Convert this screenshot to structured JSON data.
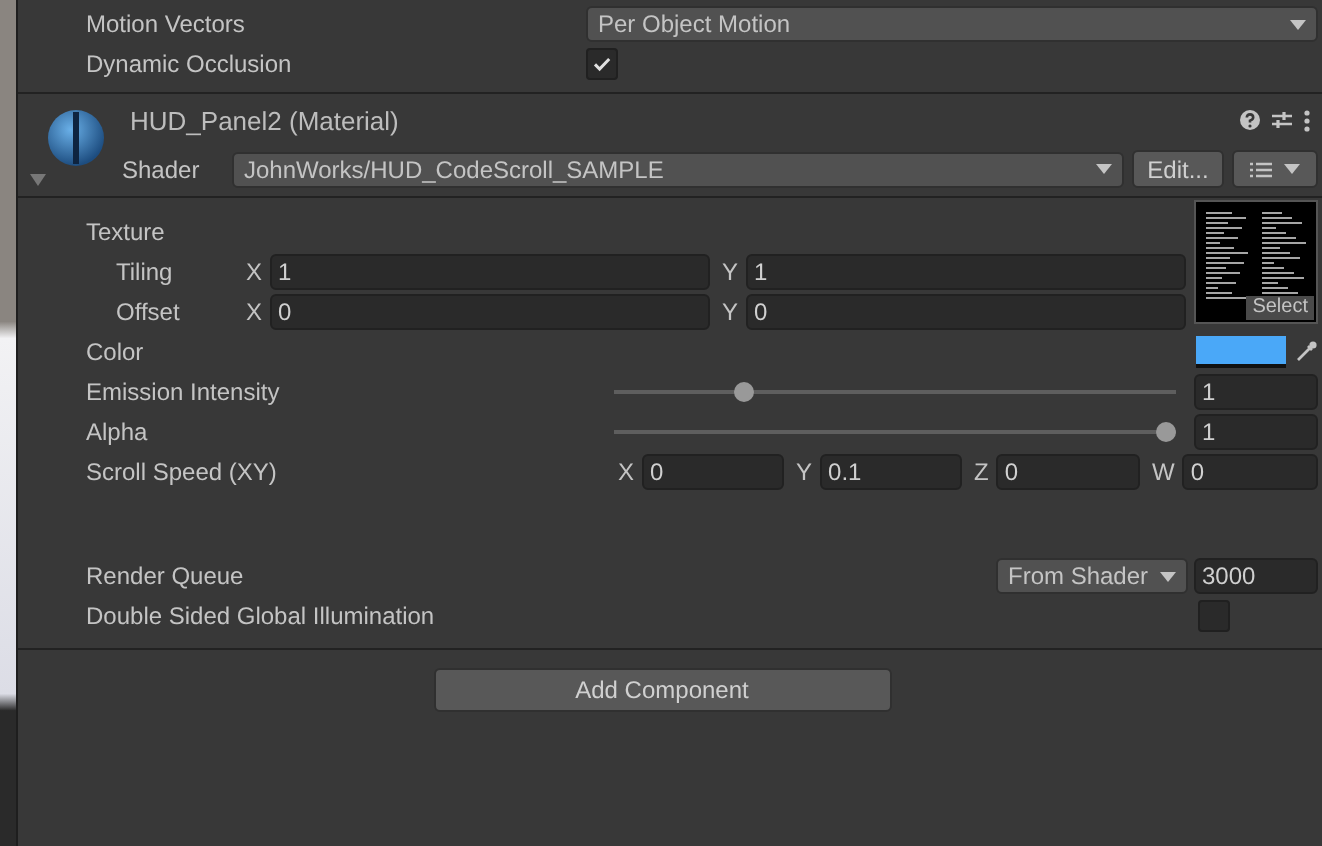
{
  "top_rows": [
    {
      "kind": "dropdown",
      "label": "Motion Vectors",
      "value": "Per Object Motion"
    },
    {
      "kind": "checkbox",
      "label": "Dynamic Occlusion",
      "checked": true
    }
  ],
  "material": {
    "title": "HUD_Panel2 (Material)",
    "shader_label": "Shader",
    "shader": "JohnWorks/HUD_CodeScroll_SAMPLE",
    "edit_button": "Edit..."
  },
  "texture": {
    "label": "Texture",
    "select_button": "Select",
    "rows": [
      {
        "label": "Tiling",
        "fields": [
          {
            "axis": "X",
            "value": "1"
          },
          {
            "axis": "Y",
            "value": "1"
          }
        ]
      },
      {
        "label": "Offset",
        "fields": [
          {
            "axis": "X",
            "value": "0"
          },
          {
            "axis": "Y",
            "value": "0"
          }
        ]
      }
    ]
  },
  "properties": [
    {
      "kind": "color",
      "label": "Color",
      "color": "#4aa8f8"
    },
    {
      "kind": "slider",
      "label": "Emission Intensity",
      "level": 0.22,
      "value": "1"
    },
    {
      "kind": "slider",
      "label": "Alpha",
      "level": 1,
      "value": "1"
    },
    {
      "kind": "vector",
      "label": "Scroll Speed (XY)",
      "fields": [
        {
          "axis": "X",
          "value": "0"
        },
        {
          "axis": "Y",
          "value": "0.1"
        },
        {
          "axis": "Z",
          "value": "0"
        },
        {
          "axis": "W",
          "value": "0"
        }
      ]
    }
  ],
  "advanced": [
    {
      "kind": "dropdown",
      "label": "Render Queue",
      "option": "From Shader",
      "value": "3000"
    },
    {
      "kind": "checkbox",
      "label": "Double Sided Global Illumination",
      "checked": false
    }
  ],
  "add_component_button": "Add Component"
}
